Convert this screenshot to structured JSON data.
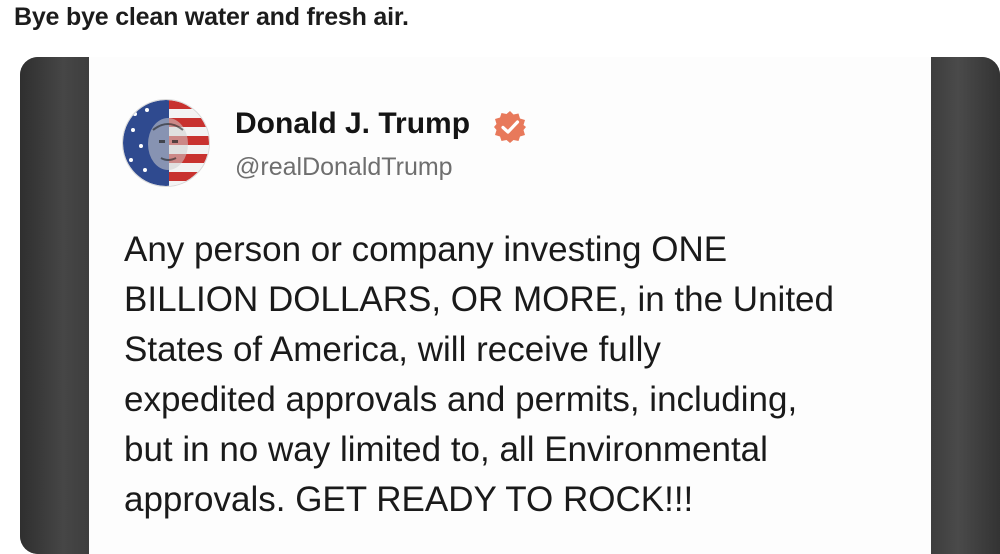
{
  "caption": "Bye bye clean water and fresh air.",
  "post": {
    "author_name": "Donald J. Trump",
    "handle": "@realDonaldTrump",
    "avatar_icon": "flag-portrait-avatar",
    "verified_icon": "verified-badge-icon",
    "accent_color": "#e8795b",
    "body_lines": [
      "Any person or company investing ONE",
      "BILLION DOLLARS, OR MORE, in the United",
      "States of America, will receive fully",
      "expedited approvals and permits, including,",
      "but in no way limited to, all Environmental",
      "approvals. GET READY TO ROCK!!!"
    ]
  }
}
